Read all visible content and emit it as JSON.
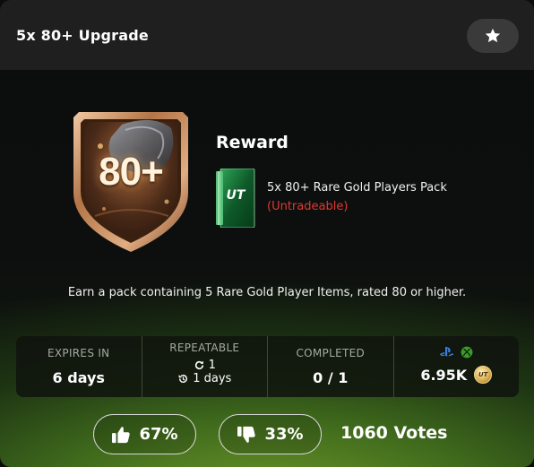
{
  "header": {
    "title": "5x 80+ Upgrade",
    "favorite_icon": "star-icon"
  },
  "badge": {
    "label": "80+",
    "icon": "shield-badge-icon"
  },
  "reward": {
    "heading": "Reward",
    "pack_icon_label": "UT",
    "pack_name": "5x 80+ Rare Gold Players Pack",
    "pack_note": "(Untradeable)"
  },
  "description": "Earn a pack containing 5 Rare Gold Player Items, rated 80 or higher.",
  "stats": {
    "expires_label": "EXPIRES IN",
    "expires_value": "6 days",
    "repeatable_label": "REPEATABLE",
    "repeatable_count": "1",
    "repeatable_interval": "1 days",
    "completed_label": "COMPLETED",
    "completed_value": "0 / 1",
    "platform_icons": [
      "playstation-icon",
      "xbox-icon"
    ],
    "price": "6.95K",
    "coin_label": "UT"
  },
  "votes": {
    "up_percent": "67%",
    "down_percent": "33%",
    "total": "1060 Votes"
  },
  "colors": {
    "accent_green": "#1f8a3a",
    "untradeable_red": "#e2382f",
    "bronze": "#c98d5f",
    "coin_gold": "#d6aa48"
  }
}
